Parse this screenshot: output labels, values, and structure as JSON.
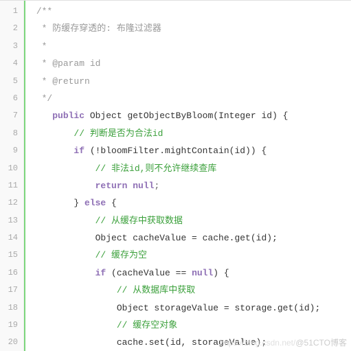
{
  "editor": {
    "start_line": 1,
    "lines": [
      {
        "indent": " ",
        "cls": "c-comment",
        "text": "/**"
      },
      {
        "indent": "  ",
        "cls": "c-comment",
        "text": "* 防缓存穿透的: 布隆过滤器"
      },
      {
        "indent": "  ",
        "cls": "c-comment",
        "text": "*"
      },
      {
        "indent": "  ",
        "cls": "c-annot",
        "text": "* @param id"
      },
      {
        "indent": "  ",
        "cls": "c-annot",
        "text": "* @return"
      },
      {
        "indent": "  ",
        "cls": "c-comment",
        "text": "*/"
      },
      {
        "tokens": [
          {
            "t": "    ",
            "cls": ""
          },
          {
            "t": "public",
            "cls": "c-kw"
          },
          {
            "t": " Object getObjectByBloom(Integer id) {",
            "cls": "c-ident"
          }
        ]
      },
      {
        "indent": "        ",
        "cls": "c-cmt-zh",
        "text": "// 判断是否为合法id"
      },
      {
        "tokens": [
          {
            "t": "        ",
            "cls": ""
          },
          {
            "t": "if",
            "cls": "c-kw"
          },
          {
            "t": " (!bloomFilter.mightContain(id)) {",
            "cls": "c-ident"
          }
        ]
      },
      {
        "indent": "            ",
        "cls": "c-cmt-zh",
        "text": "// 非法id,则不允许继续查库"
      },
      {
        "tokens": [
          {
            "t": "            ",
            "cls": ""
          },
          {
            "t": "return",
            "cls": "c-kw"
          },
          {
            "t": " ",
            "cls": ""
          },
          {
            "t": "null",
            "cls": "c-kw"
          },
          {
            "t": ";",
            "cls": "c-punct"
          }
        ]
      },
      {
        "tokens": [
          {
            "t": "        } ",
            "cls": "c-ident"
          },
          {
            "t": "else",
            "cls": "c-kw"
          },
          {
            "t": " {",
            "cls": "c-ident"
          }
        ]
      },
      {
        "indent": "            ",
        "cls": "c-cmt-zh",
        "text": "// 从缓存中获取数据"
      },
      {
        "indent": "            ",
        "cls": "c-ident",
        "text": "Object cacheValue = cache.get(id);"
      },
      {
        "indent": "            ",
        "cls": "c-cmt-zh",
        "text": "// 缓存为空"
      },
      {
        "tokens": [
          {
            "t": "            ",
            "cls": ""
          },
          {
            "t": "if",
            "cls": "c-kw"
          },
          {
            "t": " (cacheValue == ",
            "cls": "c-ident"
          },
          {
            "t": "null",
            "cls": "c-kw"
          },
          {
            "t": ") {",
            "cls": "c-ident"
          }
        ]
      },
      {
        "indent": "                ",
        "cls": "c-cmt-zh",
        "text": "// 从数据库中获取"
      },
      {
        "indent": "                ",
        "cls": "c-ident",
        "text": "Object storageValue = storage.get(id);"
      },
      {
        "indent": "                ",
        "cls": "c-cmt-zh",
        "text": "// 缓存空对象"
      },
      {
        "indent": "                ",
        "cls": "c-ident",
        "text": "cache.set(id, storageValue);"
      }
    ]
  },
  "watermark": {
    "faint": "https://blog.csdn.net/",
    "main": "@51CTO博客"
  }
}
